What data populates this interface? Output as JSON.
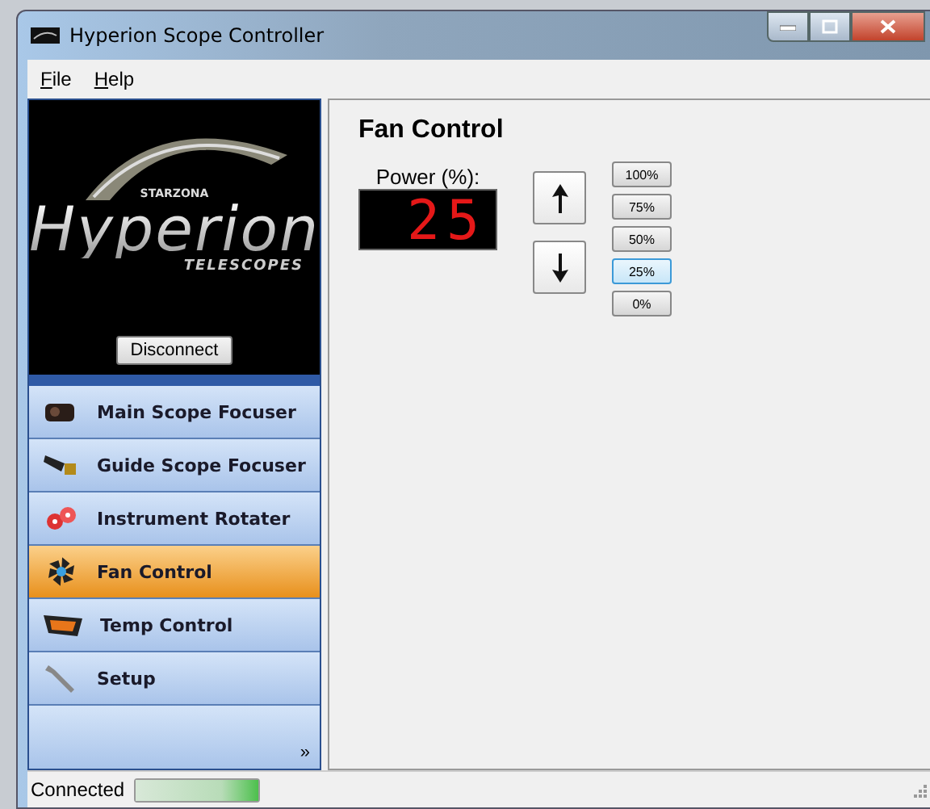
{
  "window": {
    "title": "Hyperion Scope Controller"
  },
  "menu": [
    {
      "label": "File"
    },
    {
      "label": "Help"
    }
  ],
  "logo": {
    "brand": "STARZONA",
    "name": "Hyperion",
    "tagline": "TELESCOPES"
  },
  "disconnect_button": "Disconnect",
  "nav": [
    {
      "label": "Main Scope Focuser",
      "kind": "focuser",
      "selected": false
    },
    {
      "label": "Guide Scope Focuser",
      "kind": "guide",
      "selected": false
    },
    {
      "label": "Instrument Rotater",
      "kind": "rotater",
      "selected": false
    },
    {
      "label": "Fan Control",
      "kind": "fan",
      "selected": true
    },
    {
      "label": "Temp Control",
      "kind": "temp",
      "selected": false
    },
    {
      "label": "Setup",
      "kind": "setup",
      "selected": false
    }
  ],
  "overflow_button": "»",
  "panel": {
    "title": "Fan Control",
    "power_label": "Power (%):",
    "power_value": "25",
    "presets": [
      {
        "label": "100%",
        "selected": false
      },
      {
        "label": "75%",
        "selected": false
      },
      {
        "label": "50%",
        "selected": false
      },
      {
        "label": "25%",
        "selected": true
      },
      {
        "label": "0%",
        "selected": false
      }
    ]
  },
  "status_bar": {
    "text": "Connected",
    "level": 1
  }
}
